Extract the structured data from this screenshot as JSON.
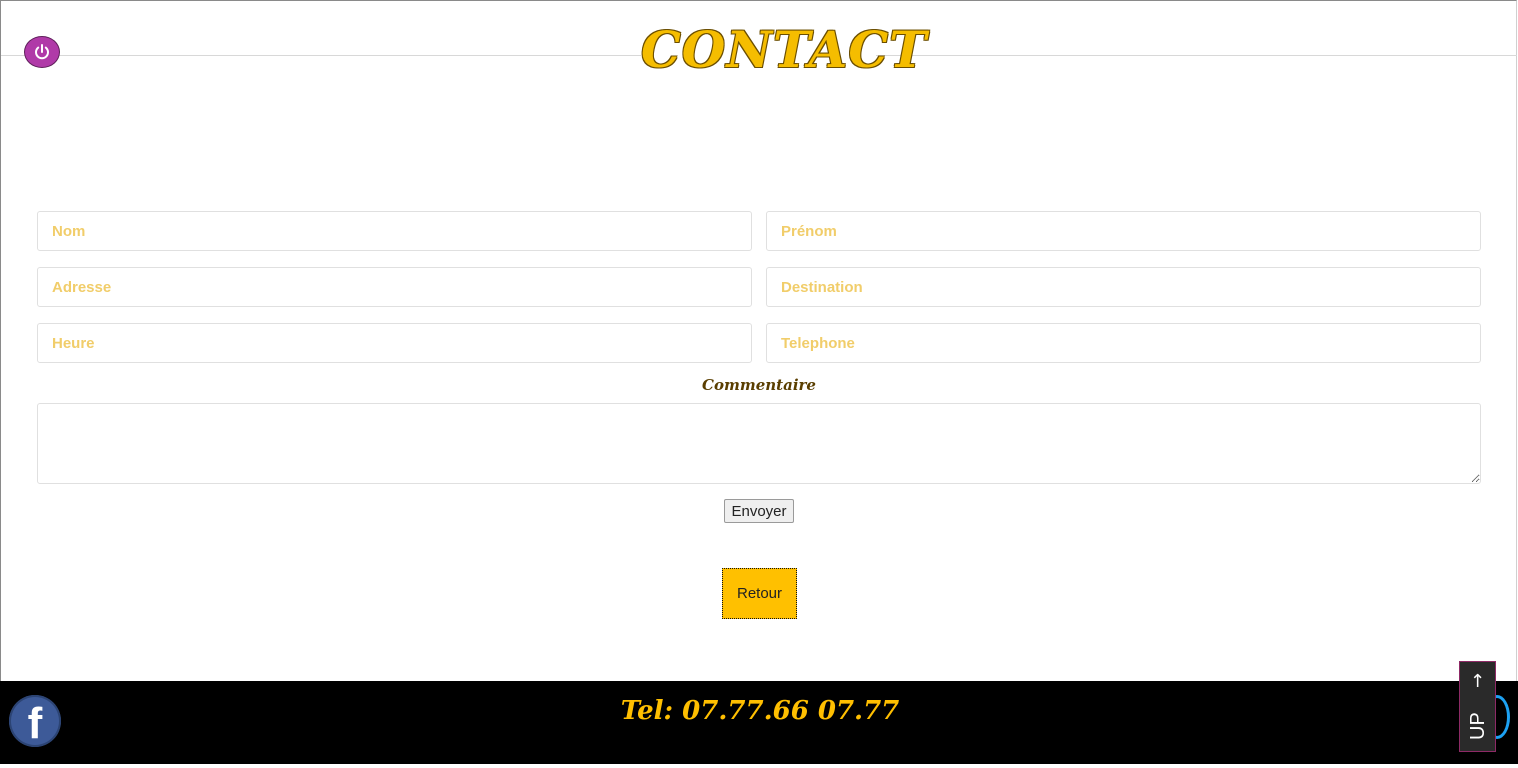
{
  "header": {
    "title": "CONTACT",
    "power_icon": "power-icon"
  },
  "form": {
    "nom_placeholder": "Nom",
    "prenom_placeholder": "Prénom",
    "adresse_placeholder": "Adresse",
    "destination_placeholder": "Destination",
    "heure_placeholder": "Heure",
    "telephone_placeholder": "Telephone",
    "comment_label": "Commentaire",
    "comment_value": "",
    "send_label": "Envoyer"
  },
  "back_label": "Retour",
  "footer": {
    "phone": "Tel: 07.77.66 07.77",
    "facebook_letter": "f",
    "facebook_icon": "facebook-icon",
    "partial_icon": "twitter-icon"
  },
  "scroll_top": {
    "arrow": "↑",
    "label": "UP"
  },
  "colors": {
    "accent": "#ffc000",
    "title": "#f5bd00",
    "power": "#b03aa8",
    "footer_bg": "#000000",
    "facebook": "#3d5a98"
  }
}
